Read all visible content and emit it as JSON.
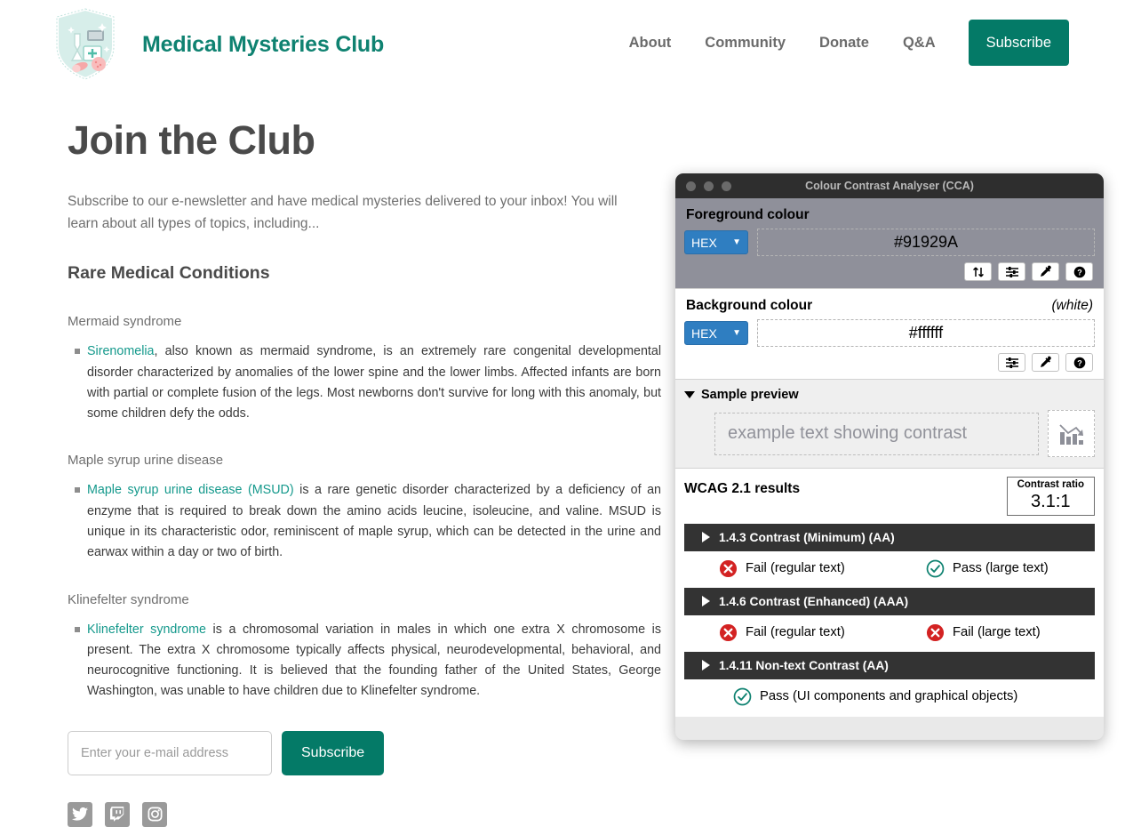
{
  "site": {
    "brand_name": "Medical Mysteries Club",
    "logo_icon": "shield-lab-logo",
    "nav": [
      {
        "label": "About",
        "name": "nav-link-about"
      },
      {
        "label": "Community",
        "name": "nav-link-community"
      },
      {
        "label": "Donate",
        "name": "nav-link-donate"
      },
      {
        "label": "Q&A",
        "name": "nav-link-qa"
      }
    ],
    "nav_cta": "Subscribe",
    "accent_color": "#047a67",
    "link_color": "#15998c"
  },
  "main": {
    "page_title": "Join the Club",
    "intro": "Subscribe to our e-newsletter and have medical mysteries delivered to your inbox! You will learn about all types of topics, including...",
    "section_title": "Rare Medical Conditions",
    "conditions": [
      {
        "heading": "Mermaid syndrome",
        "link_text": "Sirenomelia",
        "body": ", also known as mermaid syndrome, is an extremely rare congenital developmental disorder characterized by anomalies of the lower spine and the lower limbs. Affected infants are born with partial or complete fusion of the legs. Most newborns don't survive for long with this anomaly, but some children defy the odds."
      },
      {
        "heading": "Maple syrup urine disease",
        "link_text": "Maple syrup urine disease (MSUD)",
        "body": " is a rare genetic disorder characterized by a deficiency of an enzyme that is required to break down the amino acids leucine, isoleucine, and valine. MSUD is unique in its characteristic odor, reminiscent of maple syrup, which can be detected in the urine and earwax within a day or two of birth."
      },
      {
        "heading": "Klinefelter syndrome",
        "link_text": "Klinefelter syndrome",
        "body": " is a chromosomal variation in males in which one extra X chromosome is present. The extra X chromosome typically affects physical, neurodevelopmental, behavioral, and neurocognitive functioning. It is believed that the founding father of the United States, George Washington, was unable to have children due to Klinefelter syndrome."
      }
    ],
    "email_placeholder": "Enter your e-mail address",
    "email_value": "",
    "subscribe_button": "Subscribe",
    "socials": [
      {
        "name": "twitter-icon",
        "label": "Twitter"
      },
      {
        "name": "twitch-icon",
        "label": "Twitch"
      },
      {
        "name": "instagram-icon",
        "label": "Instagram"
      }
    ]
  },
  "cca": {
    "window_title": "Colour Contrast Analyser (CCA)",
    "traffic_lights": [
      "close",
      "minimize",
      "maximize"
    ],
    "foreground": {
      "label": "Foreground colour",
      "format": "HEX",
      "value": "#91929A",
      "icons": [
        {
          "name": "swap-colours-icon",
          "title": "Swap colours"
        },
        {
          "name": "sliders-icon",
          "title": "Colour sliders"
        },
        {
          "name": "eyedropper-icon",
          "title": "Pick colour"
        },
        {
          "name": "help-icon",
          "title": "Help"
        }
      ]
    },
    "background": {
      "label": "Background colour",
      "note": "(white)",
      "format": "HEX",
      "value": "#ffffff",
      "icons": [
        {
          "name": "sliders-icon",
          "title": "Colour sliders"
        },
        {
          "name": "eyedropper-icon",
          "title": "Pick colour"
        },
        {
          "name": "help-icon",
          "title": "Help"
        }
      ]
    },
    "preview": {
      "label": "Sample preview",
      "expanded": true,
      "sample_text": "example text showing contrast",
      "image_icon": "declining-bar-chart-icon"
    },
    "results": {
      "title": "WCAG 2.1 results",
      "ratio_label": "Contrast ratio",
      "ratio_value": "3.1:1",
      "criteria": [
        {
          "title": "1.4.3 Contrast (Minimum) (AA)",
          "expanded": false,
          "verdicts": [
            {
              "status": "fail",
              "text": "Fail (regular text)"
            },
            {
              "status": "pass",
              "text": "Pass (large text)"
            }
          ]
        },
        {
          "title": "1.4.6 Contrast (Enhanced) (AAA)",
          "expanded": false,
          "verdicts": [
            {
              "status": "fail",
              "text": "Fail (regular text)"
            },
            {
              "status": "fail",
              "text": "Fail (large text)"
            }
          ]
        },
        {
          "title": "1.4.11 Non-text Contrast (AA)",
          "expanded": false,
          "verdicts": [
            {
              "status": "pass",
              "text": "Pass (UI components and graphical objects)"
            }
          ]
        }
      ],
      "pass_color": "#0f8271",
      "fail_color": "#d32222"
    }
  }
}
